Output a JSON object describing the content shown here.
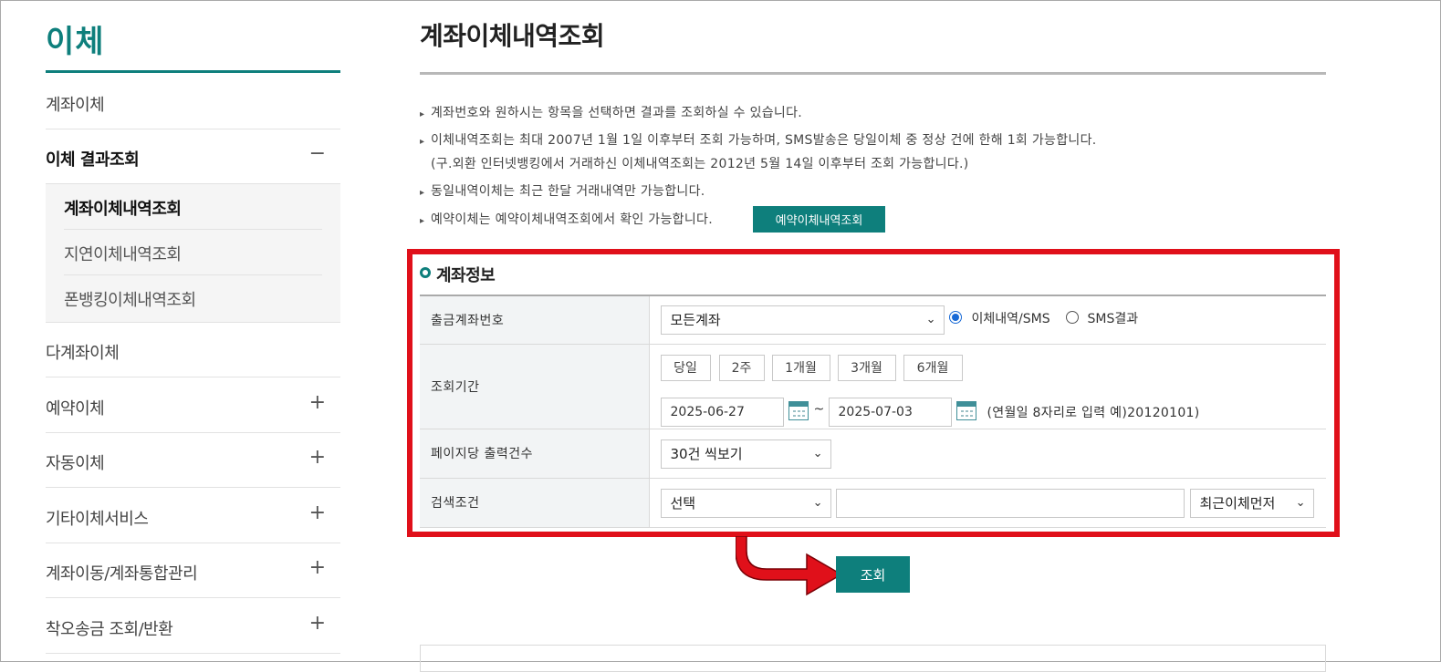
{
  "sidebar": {
    "title": "이체",
    "items": [
      {
        "label": "계좌이체",
        "sign": ""
      },
      {
        "label": "이체 결과조회",
        "sign": "−"
      },
      {
        "label": "다계좌이체",
        "sign": ""
      },
      {
        "label": "예약이체",
        "sign": "+"
      },
      {
        "label": "자동이체",
        "sign": "+"
      },
      {
        "label": "기타이체서비스",
        "sign": "+"
      },
      {
        "label": "계좌이동/계좌통합관리",
        "sign": "+"
      },
      {
        "label": "착오송금 조회/반환",
        "sign": "+"
      }
    ],
    "subitems": [
      {
        "label": "계좌이체내역조회"
      },
      {
        "label": "지연이체내역조회"
      },
      {
        "label": "폰뱅킹이체내역조회"
      }
    ]
  },
  "main": {
    "title": "계좌이체내역조회",
    "notices": [
      "계좌번호와 원하시는 항목을 선택하면 결과를 조회하실 수 있습니다.",
      "이체내역조회는 최대 2007년 1월 1일 이후부터 조회 가능하며, SMS발송은 당일이체 중 정상 건에 한해 1회 가능합니다.",
      "(구.외환 인터넷뱅킹에서 거래하신 이체내역조회는 2012년 5월 14일 이후부터 조회 가능합니다.)",
      "동일내역이체는 최근 한달 거래내역만 가능합니다.",
      "예약이체는 예약이체내역조회에서 확인 가능합니다."
    ],
    "reserve_button": "예약이체내역조회",
    "section_title": "계좌정보",
    "form": {
      "account_label": "출금계좌번호",
      "account_value": "모든계좌",
      "radio_1": "이체내역/SMS",
      "radio_2": "SMS결과",
      "period_label": "조회기간",
      "period_buttons": [
        "당일",
        "2주",
        "1개월",
        "3개월",
        "6개월"
      ],
      "date_from": "2025-06-27",
      "date_to": "2025-07-03",
      "tilde": "~",
      "date_hint": "(연월일 8자리로 입력 예)20120101)",
      "per_page_label": "페이지당 출력건수",
      "per_page_value": "30건 씩보기",
      "search_cond_label": "검색조건",
      "search_cond_value": "선택",
      "search_text_value": "",
      "sort_value": "최근이체먼저"
    },
    "search_button": "조회"
  },
  "colors": {
    "accent": "#0e7f7c",
    "highlight": "#e0101a",
    "radio_checked": "#1769d6"
  }
}
